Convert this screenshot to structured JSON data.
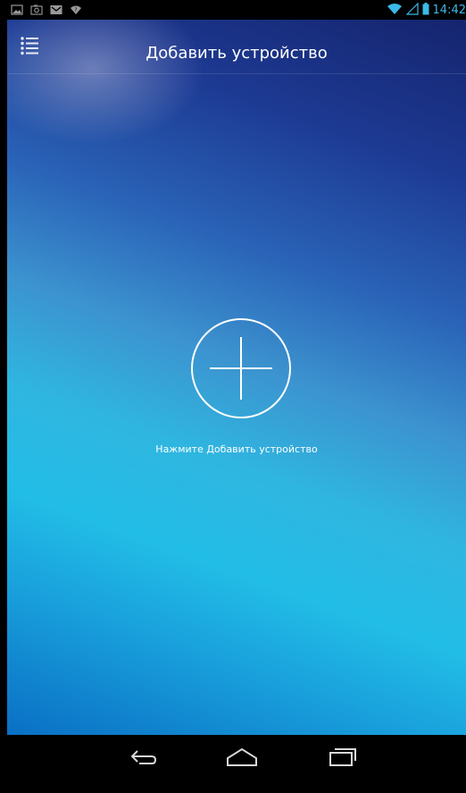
{
  "status_bar": {
    "time": "14:42",
    "icons": [
      "image-notification-icon",
      "screenshot-notification-icon",
      "gmail-notification-icon",
      "wifi-question-icon",
      "wifi-icon",
      "signal-icon",
      "battery-icon"
    ]
  },
  "app_bar": {
    "title": "Добавить устройство",
    "menu_icon": "list-menu-icon"
  },
  "main": {
    "add_icon": "plus-circle-icon",
    "hint": "Нажмите Добавить устройство"
  },
  "nav_bar": {
    "icons": [
      "back-icon",
      "home-icon",
      "recents-icon"
    ]
  },
  "colors": {
    "status_accent": "#3bb9e8",
    "gradient_top": "#15246e",
    "gradient_mid": "#22bde6",
    "gradient_bottom": "#0a6fc4"
  }
}
